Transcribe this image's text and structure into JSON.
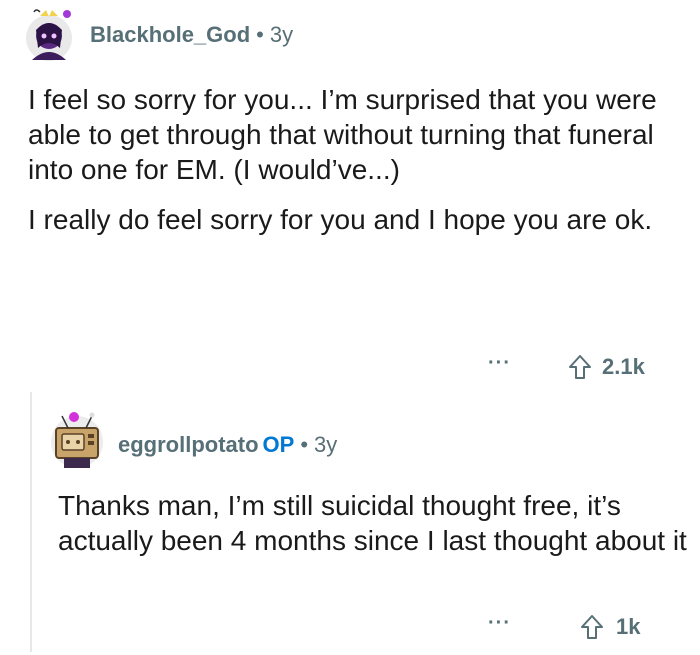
{
  "comments": [
    {
      "username": "Blackhole_God",
      "separator": "•",
      "age": "3y",
      "paragraphs": [
        "I feel so sorry for you... I’m surprised that you were able to get through that without turning that funeral into one for EM. (I would’ve...)",
        "I really do feel sorry for you and I hope you are ok."
      ],
      "more_label": "···",
      "score": "2.1k"
    },
    {
      "username": "eggrollpotato",
      "op_badge": "OP",
      "separator": "•",
      "age": "3y",
      "paragraphs": [
        "Thanks man, I’m still suicidal thought free, it’s actually been 4 months since I last thought about it"
      ],
      "more_label": "···",
      "score": "1k"
    }
  ],
  "colors": {
    "meta_text": "#576f76",
    "op_badge": "#0079d3",
    "body_text": "#1a1a1b"
  },
  "icons": [
    "avatar",
    "upvote-arrow-icon",
    "more-options-icon"
  ]
}
